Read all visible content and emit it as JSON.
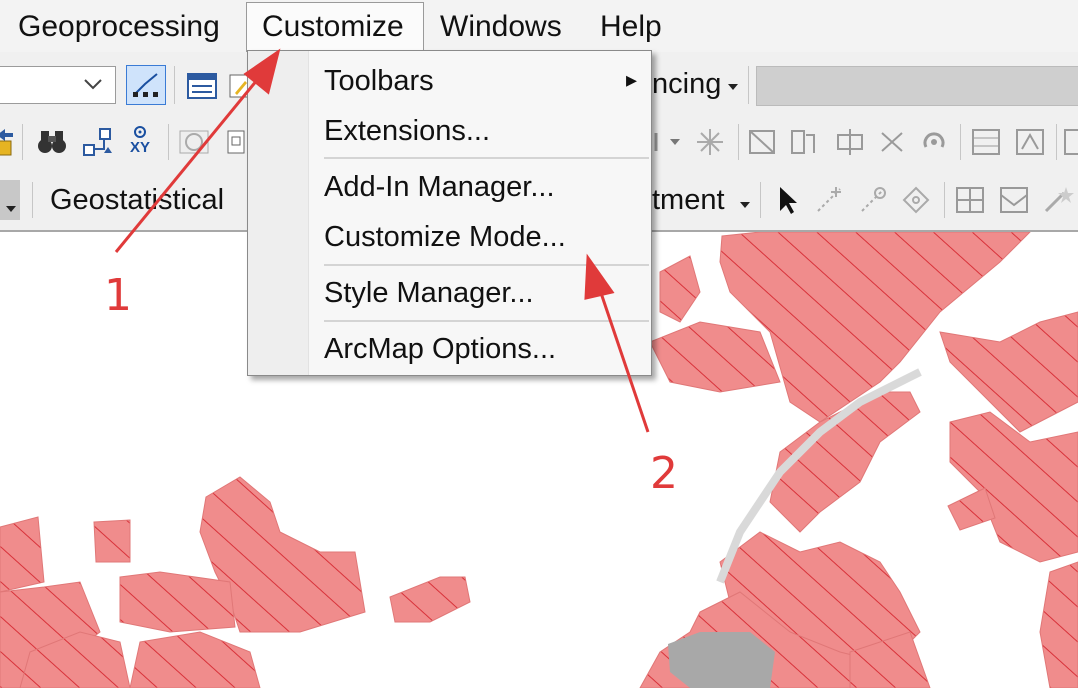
{
  "menubar": {
    "items": [
      "Geoprocessing",
      "Customize",
      "Windows",
      "Help"
    ]
  },
  "toolbar": {
    "partial_label_row1": "ncing",
    "geostatistical_label": "Geostatistical",
    "partial_label_row3": "tment",
    "xy_icon_text": "XY"
  },
  "customize_menu": {
    "items": [
      "Toolbars",
      "Extensions...",
      "Add-In Manager...",
      "Customize Mode...",
      "Style Manager...",
      "ArcMap Options..."
    ],
    "submenu_arrow": "▸"
  },
  "annotations": {
    "step1": "1",
    "step2": "2"
  },
  "colors": {
    "hatch_fill": "#f08c8c",
    "hatch_line": "#d8323a",
    "arrow": "#e03a3a",
    "road": "#d9d9d9",
    "gray_parcel": "#a8a8a8"
  }
}
